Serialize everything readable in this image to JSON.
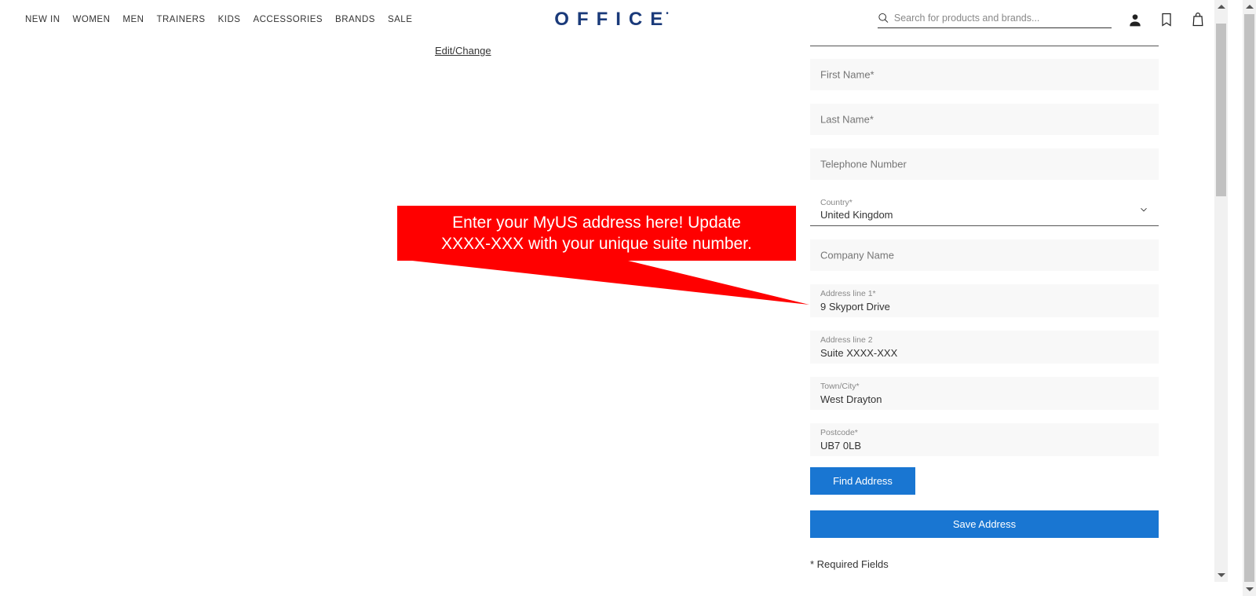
{
  "header": {
    "nav": [
      "NEW IN",
      "WOMEN",
      "MEN",
      "TRAINERS",
      "KIDS",
      "ACCESSORIES",
      "BRANDS",
      "SALE"
    ],
    "logo_text": "OFFICE",
    "search_placeholder": "Search for products and brands..."
  },
  "edit_change": "Edit/Change",
  "callout": {
    "line1": "Enter your MyUS address here! Update",
    "line2": "XXXX-XXX with your unique suite number."
  },
  "form": {
    "first_name": {
      "placeholder": "First Name*",
      "value": ""
    },
    "last_name": {
      "placeholder": "Last Name*",
      "value": ""
    },
    "telephone": {
      "placeholder": "Telephone Number",
      "value": ""
    },
    "country": {
      "label": "Country*",
      "value": "United Kingdom"
    },
    "company": {
      "placeholder": "Company Name",
      "value": ""
    },
    "addr1": {
      "label": "Address line 1*",
      "value": "9 Skyport Drive"
    },
    "addr2": {
      "label": "Address line 2",
      "value": "Suite XXXX-XXX"
    },
    "town": {
      "label": "Town/City*",
      "value": "West Drayton"
    },
    "postcode": {
      "label": "Postcode*",
      "value": "UB7 0LB"
    },
    "find_btn": "Find Address",
    "save_btn": "Save Address",
    "required": "* Required Fields"
  }
}
